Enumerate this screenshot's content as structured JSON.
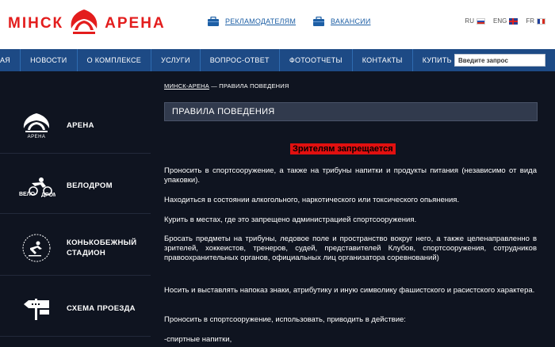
{
  "header": {
    "logo_left": "МIНСК",
    "logo_right": "АРЕНА",
    "links": [
      {
        "label": "РЕКЛАМОДАТЕЛЯМ",
        "icon": "briefcase-icon"
      },
      {
        "label": "ВАКАНСИИ",
        "icon": "briefcase-icon"
      }
    ],
    "languages": [
      {
        "code": "RU",
        "flag": "ru"
      },
      {
        "code": "ENG",
        "flag": "en"
      },
      {
        "code": "FR",
        "flag": "fr"
      }
    ]
  },
  "nav": {
    "items": [
      "АЯ",
      "НОВОСТИ",
      "О КОМПЛЕКСЕ",
      "УСЛУГИ",
      "ВОПРОС-ОТВЕТ",
      "ФОТООТЧЕТЫ",
      "КОНТАКТЫ",
      "КУПИТЬ БИЛЕТ"
    ],
    "search_placeholder": "Введите запрос"
  },
  "sidebar": {
    "items": [
      {
        "label": "АРЕНА",
        "icon": "arena-icon",
        "caption": "АРЕНА"
      },
      {
        "label": "ВЕЛОДРОМ",
        "icon": "velodrome-icon",
        "caption": ""
      },
      {
        "label": "КОНЬКОБЕЖНЫЙ СТАДИОН",
        "icon": "skating-stadium-icon",
        "caption": ""
      },
      {
        "label": "СХЕМА ПРОЕЗДА",
        "icon": "signpost-icon",
        "caption": ""
      }
    ]
  },
  "main": {
    "breadcrumb_link": "МИНСК-АРЕНА",
    "breadcrumb_sep": " — ",
    "breadcrumb_current": "ПРАВИЛА ПОВЕДЕНИЯ",
    "title": "ПРАВИЛА ПОВЕДЕНИЯ",
    "forbidden_heading": "Зрителям запрещается",
    "paragraphs": [
      "Проносить в спортсооружение, а также на трибуны напитки и продукты питания (независимо от вида упаковки).",
      "Находиться в состоянии алкогольного, наркотического или токсического опьянения.",
      "Курить в местах, где это запрещено администрацией спортсооружения.",
      "Бросать предметы на трибуны, ледовое поле и пространство вокруг него, а также целенаправленно в зрителей, хоккеистов, тренеров, судей, представителей Клубов, спортсооружения, сотрудников правоохранительных органов, официальных лиц организатора соревнований)",
      "Носить и выставлять напоказ знаки, атрибутику и иную символику фашистского и расистского характера.",
      "Проносить в спортсооружение, использовать, приводить в действие:",
      " -спиртные напитки,"
    ]
  },
  "colors": {
    "brand_red": "#e31d1d",
    "nav_blue": "#1d4a85",
    "page_bg": "#0f1420",
    "title_bar": "#313a4d",
    "highlight_red": "#e11010"
  }
}
